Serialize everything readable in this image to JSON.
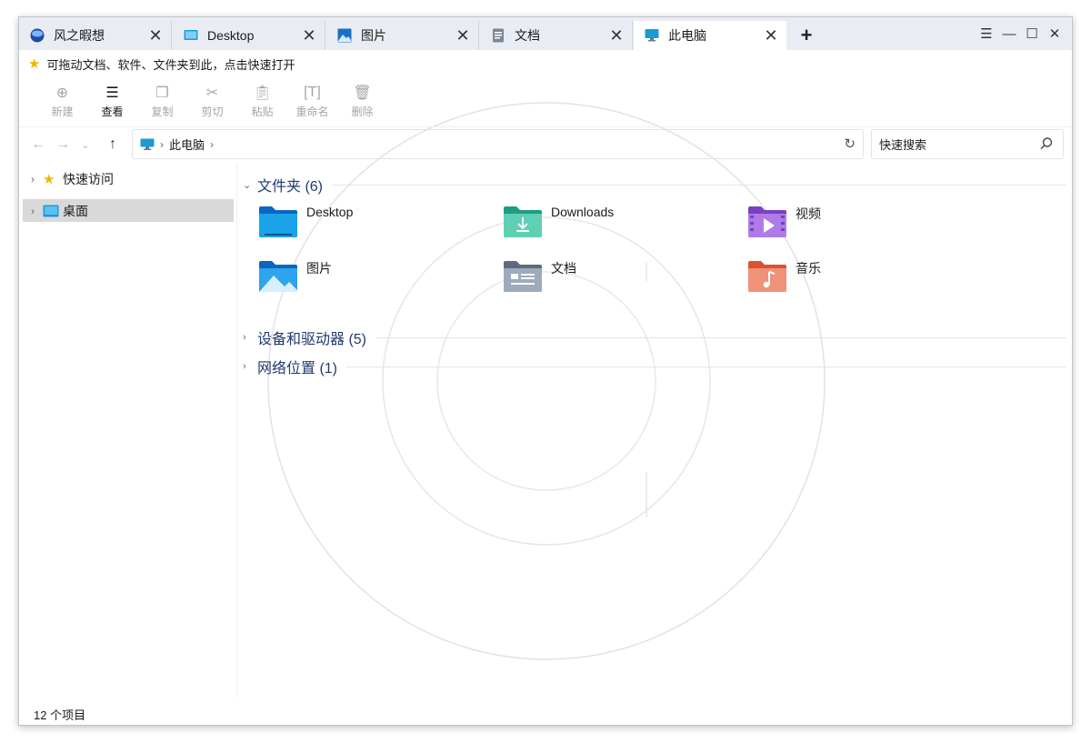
{
  "tabs": [
    {
      "label": "风之暇想",
      "icon": "globe-icon"
    },
    {
      "label": "Desktop",
      "icon": "desktop-icon"
    },
    {
      "label": "图片",
      "icon": "pictures-icon"
    },
    {
      "label": "文档",
      "icon": "document-icon"
    },
    {
      "label": "此电脑",
      "icon": "computer-icon",
      "active": true
    }
  ],
  "new_tab_label": "+",
  "window_controls": {
    "menu": "☰",
    "minimize": "—",
    "maximize": "☐",
    "close": "✕"
  },
  "hint_text": "可拖动文档、软件、文件夹到此，点击快速打开",
  "toolbar": {
    "new_label": "新建",
    "view_label": "查看",
    "copy_label": "复制",
    "cut_label": "剪切",
    "paste_label": "粘贴",
    "rename_label": "重命名",
    "delete_label": "删除"
  },
  "address": {
    "crumb": "此电脑"
  },
  "search": {
    "placeholder": "快速搜索"
  },
  "sidebar": {
    "items": [
      {
        "label": "快速访问",
        "icon": "star-icon"
      },
      {
        "label": "桌面",
        "icon": "desktop-icon",
        "selected": true
      }
    ]
  },
  "main": {
    "groups": [
      {
        "label": "文件夹 (6)",
        "expanded": true
      },
      {
        "label": "设备和驱动器 (5)",
        "expanded": false
      },
      {
        "label": "网络位置 (1)",
        "expanded": false
      }
    ],
    "folders": [
      {
        "label": "Desktop",
        "icon": "desktop-folder-icon"
      },
      {
        "label": "Downloads",
        "icon": "downloads-folder-icon"
      },
      {
        "label": "视频",
        "icon": "videos-folder-icon"
      },
      {
        "label": "图片",
        "icon": "pictures-folder-icon"
      },
      {
        "label": "文档",
        "icon": "documents-folder-icon"
      },
      {
        "label": "音乐",
        "icon": "music-folder-icon"
      }
    ]
  },
  "status": {
    "count_text": "12 个项目"
  },
  "colors": {
    "accent": "#1f3a6e",
    "tabbar": "#e9edf3",
    "selected": "#d9d9d9"
  }
}
